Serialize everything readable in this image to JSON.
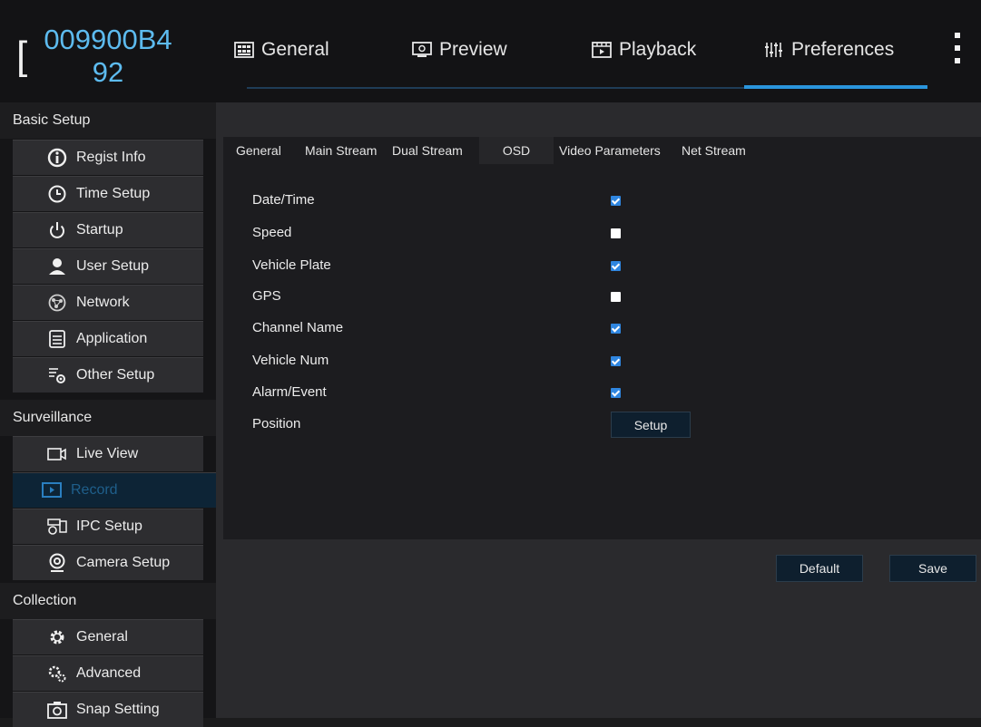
{
  "header": {
    "device_id": "009900B492",
    "tabs": [
      {
        "label": "General",
        "icon": "grid-panel-icon"
      },
      {
        "label": "Preview",
        "icon": "monitor-icon"
      },
      {
        "label": "Playback",
        "icon": "film-icon"
      },
      {
        "label": "Preferences",
        "icon": "sliders-icon"
      }
    ],
    "active_tab": "Preferences"
  },
  "sidebar": {
    "sections": [
      {
        "title": "Basic Setup",
        "items": [
          {
            "label": "Regist Info",
            "icon": "info-icon"
          },
          {
            "label": "Time Setup",
            "icon": "clock-icon"
          },
          {
            "label": "Startup",
            "icon": "power-icon"
          },
          {
            "label": "User Setup",
            "icon": "user-icon"
          },
          {
            "label": "Network",
            "icon": "network-icon"
          },
          {
            "label": "Application",
            "icon": "application-icon"
          },
          {
            "label": "Other Setup",
            "icon": "other-setup-icon"
          }
        ]
      },
      {
        "title": "Surveillance",
        "items": [
          {
            "label": "Live View",
            "icon": "video-camera-icon"
          },
          {
            "label": "Record",
            "icon": "record-icon"
          },
          {
            "label": "IPC Setup",
            "icon": "ipc-icon"
          },
          {
            "label": "Camera Setup",
            "icon": "webcam-icon"
          }
        ]
      },
      {
        "title": "Collection",
        "items": [
          {
            "label": "General",
            "icon": "gear-icon"
          },
          {
            "label": "Advanced",
            "icon": "gears-icon"
          },
          {
            "label": "Snap Setting",
            "icon": "camera-icon"
          }
        ]
      }
    ],
    "active_item": "Record"
  },
  "subtabs": [
    "General",
    "Main Stream",
    "Dual Stream",
    "OSD",
    "Video Parameters",
    "Net Stream"
  ],
  "active_subtab": "OSD",
  "osd": {
    "rows": [
      {
        "label": "Date/Time",
        "checked": true
      },
      {
        "label": "Speed",
        "checked": false
      },
      {
        "label": "Vehicle Plate",
        "checked": true
      },
      {
        "label": "GPS",
        "checked": false
      },
      {
        "label": "Channel Name",
        "checked": true
      },
      {
        "label": "Vehicle Num",
        "checked": true
      },
      {
        "label": "Alarm/Event",
        "checked": true
      }
    ],
    "position_label": "Position",
    "setup_button": "Setup"
  },
  "footer": {
    "default_button": "Default",
    "save_button": "Save"
  },
  "colors": {
    "accent": "#2a95dc",
    "device_id": "#5dbbef",
    "checkbox_on": "#2f86e0",
    "active_item_bg": "#0d2436"
  }
}
